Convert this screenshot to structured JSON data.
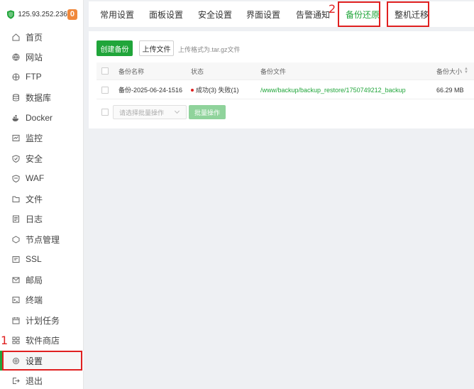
{
  "server": {
    "ip": "125.93.252.236",
    "badge": "0"
  },
  "sidebar": {
    "items": [
      {
        "label": "首页",
        "icon": "home-icon"
      },
      {
        "label": "网站",
        "icon": "globe-icon"
      },
      {
        "label": "FTP",
        "icon": "ftp-icon"
      },
      {
        "label": "数据库",
        "icon": "database-icon"
      },
      {
        "label": "Docker",
        "icon": "docker-icon"
      },
      {
        "label": "监控",
        "icon": "monitor-icon"
      },
      {
        "label": "安全",
        "icon": "shield-icon"
      },
      {
        "label": "WAF",
        "icon": "waf-icon"
      },
      {
        "label": "文件",
        "icon": "folder-icon"
      },
      {
        "label": "日志",
        "icon": "log-icon"
      },
      {
        "label": "节点管理",
        "icon": "node-icon"
      },
      {
        "label": "SSL",
        "icon": "ssl-icon"
      },
      {
        "label": "邮局",
        "icon": "mail-icon"
      },
      {
        "label": "终端",
        "icon": "terminal-icon"
      },
      {
        "label": "计划任务",
        "icon": "calendar-icon"
      },
      {
        "label": "软件商店",
        "icon": "apps-icon"
      },
      {
        "label": "设置",
        "icon": "gear-icon"
      },
      {
        "label": "退出",
        "icon": "logout-icon"
      }
    ],
    "active": "设置"
  },
  "tabs": [
    {
      "label": "常用设置"
    },
    {
      "label": "面板设置"
    },
    {
      "label": "安全设置"
    },
    {
      "label": "界面设置"
    },
    {
      "label": "告警通知"
    },
    {
      "label": "备份还原"
    },
    {
      "label": "整机迁移"
    }
  ],
  "active_tab": "备份还原",
  "annotations": {
    "sidebar_marker": "1",
    "tab_marker": "2"
  },
  "toolbar": {
    "create_label": "创建备份",
    "upload_label": "上传文件",
    "upload_hint": "上传格式为.tar.gz文件"
  },
  "table": {
    "columns": [
      "备份名称",
      "状态",
      "备份文件",
      "备份大小"
    ],
    "rows": [
      {
        "name": "备份-2025-06-24-1516",
        "status": "成功(3) 失败(1)",
        "file": "/www/backup/backup_restore/1750749212_backup",
        "size": "66.29 MB"
      }
    ]
  },
  "batch": {
    "select_placeholder": "请选择批量操作",
    "button_label": "批量操作"
  },
  "colors": {
    "accent": "#20a53a",
    "highlight": "#e02020",
    "badge": "#f0883b"
  }
}
